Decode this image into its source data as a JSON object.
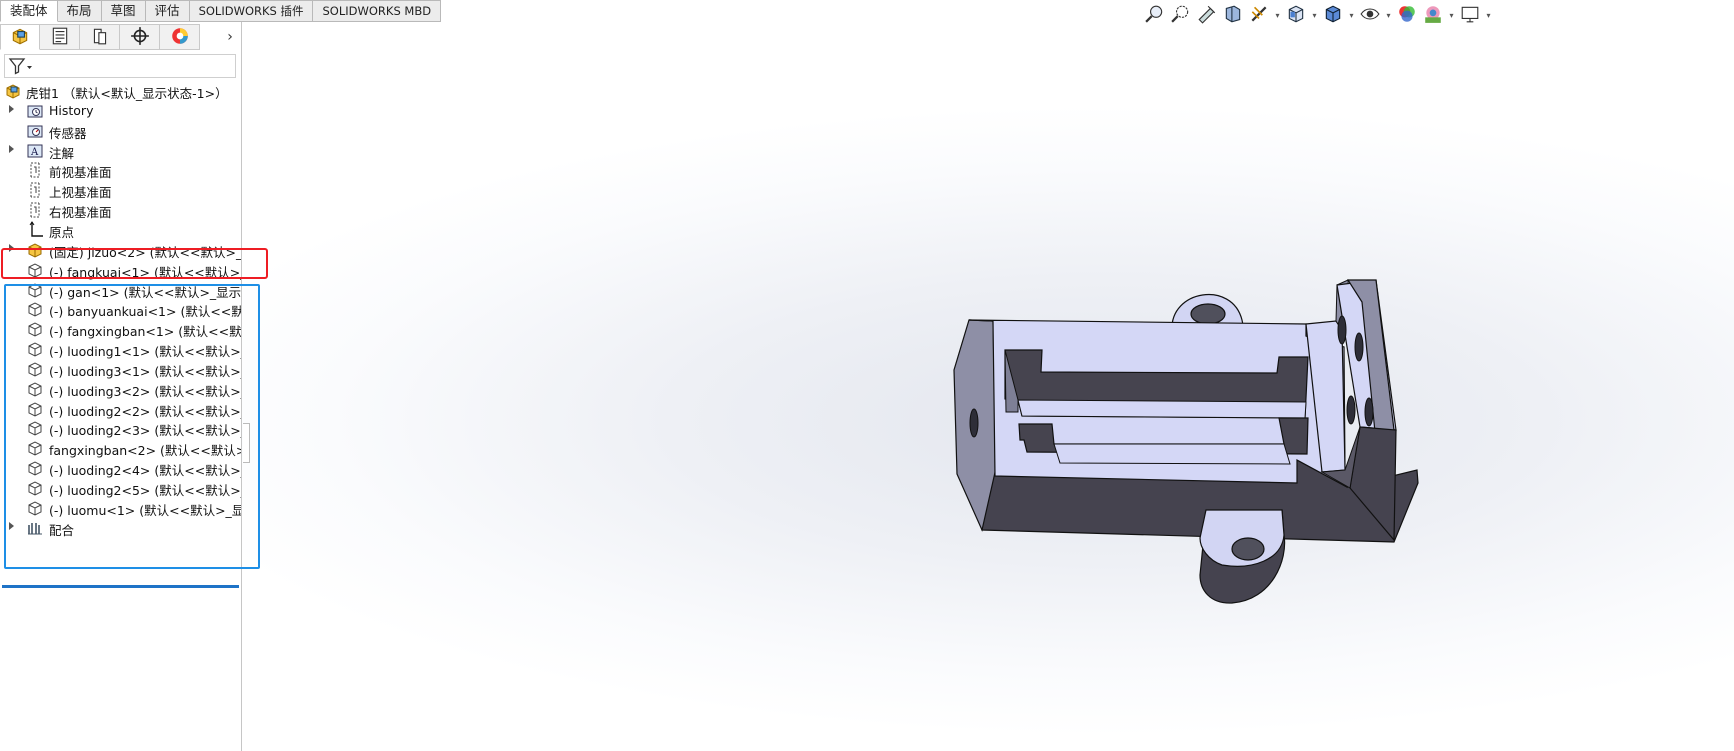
{
  "command_tabs": [
    {
      "label": "装配体",
      "active": true
    },
    {
      "label": "布局",
      "active": false
    },
    {
      "label": "草图",
      "active": false
    },
    {
      "label": "评估",
      "active": false
    },
    {
      "label": "SOLIDWORKS 插件",
      "active": false
    },
    {
      "label": "SOLIDWORKS MBD",
      "active": false
    }
  ],
  "manager_tabs": [
    {
      "icon": "featuremanager-icon",
      "active": true
    },
    {
      "icon": "propertymanager-icon",
      "active": false
    },
    {
      "icon": "configurationmanager-icon",
      "active": false
    },
    {
      "icon": "dimxpertmanager-icon",
      "active": false
    },
    {
      "icon": "displaymanager-icon",
      "active": false
    }
  ],
  "tree": {
    "root": {
      "label": "虎钳1 （默认<默认_显示状态-1>）",
      "icon": "assembly-icon"
    },
    "items": [
      {
        "label": "History",
        "icon": "history-folder-icon",
        "expandable": true
      },
      {
        "label": "传感器",
        "icon": "sensor-icon",
        "expandable": false
      },
      {
        "label": "注解",
        "icon": "annotation-icon",
        "expandable": true
      },
      {
        "label": "前视基准面",
        "icon": "plane-icon",
        "expandable": false
      },
      {
        "label": "上视基准面",
        "icon": "plane-icon",
        "expandable": false
      },
      {
        "label": "右视基准面",
        "icon": "plane-icon",
        "expandable": false
      },
      {
        "label": "原点",
        "icon": "origin-icon",
        "expandable": false
      },
      {
        "label": "(固定) jizuo<2> (默认<<默认>_显示",
        "icon": "fixed-part-icon",
        "expandable": true
      },
      {
        "label": "(-) fangkuai<1> (默认<<默认>_显",
        "icon": "part-icon",
        "expandable": false
      },
      {
        "label": "(-) gan<1> (默认<<默认>_显示状",
        "icon": "part-icon",
        "expandable": false
      },
      {
        "label": "(-) banyuankuai<1> (默认<<默认",
        "icon": "part-icon",
        "expandable": false
      },
      {
        "label": "(-) fangxingban<1> (默认<<默认",
        "icon": "part-icon",
        "expandable": false
      },
      {
        "label": "(-) luoding1<1> (默认<<默认>_显",
        "icon": "part-icon",
        "expandable": false
      },
      {
        "label": "(-) luoding3<1> (默认<<默认>_显",
        "icon": "part-icon",
        "expandable": false
      },
      {
        "label": "(-) luoding3<2> (默认<<默认>_显",
        "icon": "part-icon",
        "expandable": false
      },
      {
        "label": "(-) luoding2<2> (默认<<默认>_显",
        "icon": "part-icon",
        "expandable": false
      },
      {
        "label": "(-) luoding2<3> (默认<<默认>_显",
        "icon": "part-icon",
        "expandable": false
      },
      {
        "label": "fangxingban<2> (默认<<默认>_显",
        "icon": "part-icon",
        "expandable": false
      },
      {
        "label": "(-) luoding2<4> (默认<<默认>_显",
        "icon": "part-icon",
        "expandable": false
      },
      {
        "label": "(-) luoding2<5> (默认<<默认>_显",
        "icon": "part-icon",
        "expandable": false
      },
      {
        "label": "(-) luomu<1> (默认<<默认>_显示",
        "icon": "part-icon",
        "expandable": false
      },
      {
        "label": "配合",
        "icon": "mates-icon",
        "expandable": true
      }
    ]
  },
  "heads_up_toolbar": [
    "zoom-to-fit-icon",
    "zoom-to-area-icon",
    "previous-view-icon",
    "section-view-icon",
    "dynamic-annotation-icon",
    "view-orientation-icon",
    "display-style-icon",
    "hide-show-items-icon",
    "edit-appearance-icon",
    "apply-scene-icon",
    "view-settings-icon"
  ],
  "colors": {
    "highlight_red": "#ee1d24",
    "highlight_blue": "#1e8fe6",
    "model_top": "#d4d7f6",
    "model_side": "#8e8fa6",
    "model_dark": "#45434f"
  }
}
